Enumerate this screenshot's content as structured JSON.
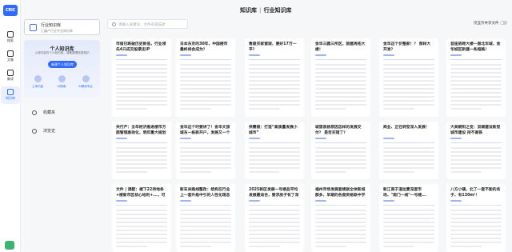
{
  "rail": {
    "logo": "CRIC 克而瑞研究",
    "items": [
      {
        "label": "搜索",
        "icon": "search-icon"
      },
      {
        "label": "文集",
        "icon": "docs-icon"
      },
      {
        "label": "解读",
        "icon": "chart-icon"
      },
      {
        "label": "知识库",
        "icon": "library-icon"
      }
    ],
    "active": 3
  },
  "sidebar": {
    "lib_title": "行业知识库",
    "lib_sub": "汇编产行业专业知识库",
    "personal": {
      "title": "个人知识库",
      "subtitle": "上传内容在个人知识库，搜集整理信息知识",
      "create_label": "新建个人知识库",
      "features": [
        "上传内容",
        "AI搜索",
        "AI解读专业"
      ]
    },
    "items": [
      {
        "label": "收藏夹"
      },
      {
        "label": "浏览史"
      }
    ]
  },
  "header": {
    "title_a": "知识库",
    "title_b": "行业知识库",
    "search_placeholder": "请输入关键词，文件名或描述",
    "collab_label": "仅显示共享文件"
  },
  "cards": [
    {
      "title": "市值已跌破历史新低，行业领先4只成交股票走IP"
    },
    {
      "title": "日本东京的30年，中国楼市最终将会成为？"
    },
    {
      "title": "售盘买家窗观，要好17万一平？"
    },
    {
      "title": "金华三圆三所区，旅建再拓大楼！"
    },
    {
      "title": "金华这个价整家！？ 那样大开发？"
    },
    {
      "title": "首座房跨大楼一盘北华城，金华城区新建一条超路！"
    },
    {
      "title": "央行产：全年经济推进楼市方面管理高效化，明年重大规划"
    },
    {
      "title": "金华这个时要讲了！金华文旅城东一栋新开户，发展又一个大型商区"
    },
    {
      "title": "供需盘：打造“高质量发展小城市”"
    },
    {
      "title": "城堡装修原因怎样的发展交付？ 是否买错了？"
    },
    {
      "title": "商业、正在转型深入发展！"
    },
    {
      "title": "大美朝阳之变：双碳建设新型城市建设 持不高铁"
    },
    {
      "title": "文件 | 调配：楼下22持地条+楼新市区核心地利+...，可你的2025！"
    },
    {
      "title": "新车关路线整改：结构在行业上一套升级中引的人性化理念"
    },
    {
      "title": "2025新区发展一号楼品平均发展最适合，要求房子有了深度"
    },
    {
      "title": "福州市场发展套楼就全体新城群多，早期的各盘资格联中学区性利信息区"
    },
    {
      "title": "新江南于道拉夏深度市场，\"南门一线\"一号楼..."
    },
    {
      "title": "八方小镇，北了一套不能的务子，有130m²！"
    }
  ]
}
